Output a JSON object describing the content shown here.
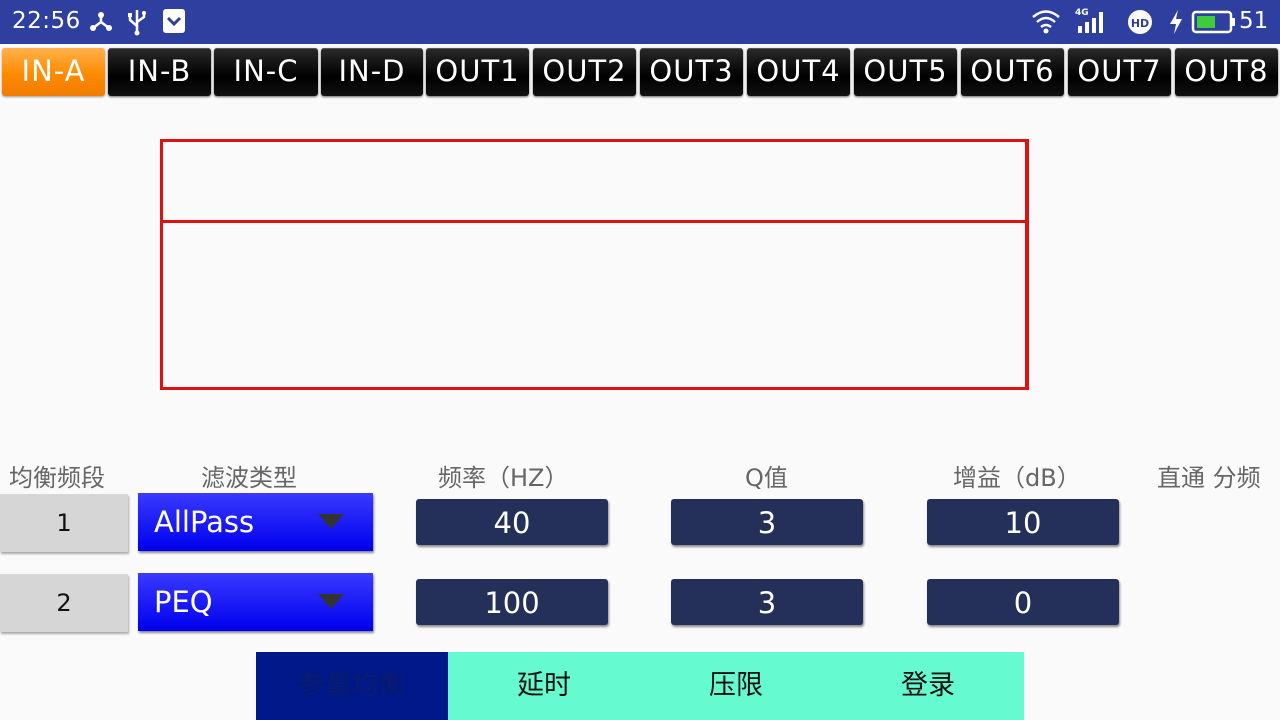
{
  "status_bar": {
    "time": "22:56",
    "battery": "51",
    "network": "4G"
  },
  "tabs": [
    "IN-A",
    "IN-B",
    "IN-C",
    "IN-D",
    "OUT1",
    "OUT2",
    "OUT3",
    "OUT4",
    "OUT5",
    "OUT6",
    "OUT7",
    "OUT8"
  ],
  "active_tab": "IN-A",
  "headers": {
    "band": "均衡频段",
    "filter_type": "滤波类型",
    "frequency": "频率（HZ）",
    "q": "Q值",
    "gain": "增益（dB）",
    "bypass": "直通 分频"
  },
  "rows": [
    {
      "band": "1",
      "filter_type": "AllPass",
      "frequency": "40",
      "q": "3",
      "gain": "10"
    },
    {
      "band": "2",
      "filter_type": "PEQ",
      "frequency": "100",
      "q": "3",
      "gain": "0"
    }
  ],
  "bottom_nav": [
    "参量均衡",
    "延时",
    "压限",
    "登录"
  ],
  "active_nav": "参量均衡",
  "colors": {
    "status_bar": "#2f3f9f",
    "active_tab": "#ff8a00",
    "graph_line": "#e01010",
    "field_bg": "#25305a",
    "nav_bg": "#66fad0",
    "nav_active": "#00188a"
  }
}
